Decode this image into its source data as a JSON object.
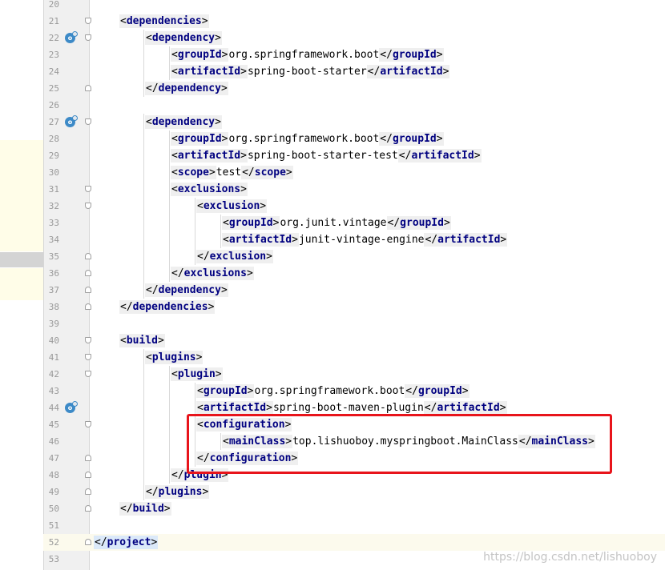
{
  "editor": {
    "lines": [
      {
        "n": "20",
        "indent": 0,
        "parts": [],
        "fold": null,
        "icon": false
      },
      {
        "n": "21",
        "indent": 1,
        "parts": [
          [
            "open",
            "dependencies"
          ]
        ],
        "fold": "open",
        "icon": false
      },
      {
        "n": "22",
        "indent": 2,
        "parts": [
          [
            "open",
            "dependency"
          ]
        ],
        "fold": "open",
        "icon": true
      },
      {
        "n": "23",
        "indent": 3,
        "parts": [
          [
            "open",
            "groupId"
          ],
          [
            "text",
            "org.springframework.boot"
          ],
          [
            "close",
            "groupId"
          ]
        ],
        "fold": null,
        "icon": false
      },
      {
        "n": "24",
        "indent": 3,
        "parts": [
          [
            "open",
            "artifactId"
          ],
          [
            "text",
            "spring-boot-starter"
          ],
          [
            "close",
            "artifactId"
          ]
        ],
        "fold": null,
        "icon": false
      },
      {
        "n": "25",
        "indent": 2,
        "parts": [
          [
            "close",
            "dependency"
          ]
        ],
        "fold": "close",
        "icon": false
      },
      {
        "n": "26",
        "indent": 0,
        "parts": [],
        "fold": null,
        "icon": false
      },
      {
        "n": "27",
        "indent": 2,
        "parts": [
          [
            "open",
            "dependency"
          ]
        ],
        "fold": "open",
        "icon": true
      },
      {
        "n": "28",
        "indent": 3,
        "parts": [
          [
            "open",
            "groupId"
          ],
          [
            "text",
            "org.springframework.boot"
          ],
          [
            "close",
            "groupId"
          ]
        ],
        "fold": null,
        "icon": false
      },
      {
        "n": "29",
        "indent": 3,
        "parts": [
          [
            "open",
            "artifactId"
          ],
          [
            "text",
            "spring-boot-starter-test"
          ],
          [
            "close",
            "artifactId"
          ]
        ],
        "fold": null,
        "icon": false
      },
      {
        "n": "30",
        "indent": 3,
        "parts": [
          [
            "open",
            "scope"
          ],
          [
            "text",
            "test"
          ],
          [
            "close",
            "scope"
          ]
        ],
        "fold": null,
        "icon": false
      },
      {
        "n": "31",
        "indent": 3,
        "parts": [
          [
            "open",
            "exclusions"
          ]
        ],
        "fold": "open",
        "icon": false
      },
      {
        "n": "32",
        "indent": 4,
        "parts": [
          [
            "open",
            "exclusion"
          ]
        ],
        "fold": "open",
        "icon": false
      },
      {
        "n": "33",
        "indent": 5,
        "parts": [
          [
            "open",
            "groupId"
          ],
          [
            "text",
            "org.junit.vintage"
          ],
          [
            "close",
            "groupId"
          ]
        ],
        "fold": null,
        "icon": false
      },
      {
        "n": "34",
        "indent": 5,
        "parts": [
          [
            "open",
            "artifactId"
          ],
          [
            "text",
            "junit-vintage-engine"
          ],
          [
            "close",
            "artifactId"
          ]
        ],
        "fold": null,
        "icon": false
      },
      {
        "n": "35",
        "indent": 4,
        "parts": [
          [
            "close",
            "exclusion"
          ]
        ],
        "fold": "close",
        "icon": false
      },
      {
        "n": "36",
        "indent": 3,
        "parts": [
          [
            "close",
            "exclusions"
          ]
        ],
        "fold": "close",
        "icon": false
      },
      {
        "n": "37",
        "indent": 2,
        "parts": [
          [
            "close",
            "dependency"
          ]
        ],
        "fold": "close",
        "icon": false
      },
      {
        "n": "38",
        "indent": 1,
        "parts": [
          [
            "close",
            "dependencies"
          ]
        ],
        "fold": "close",
        "icon": false
      },
      {
        "n": "39",
        "indent": 0,
        "parts": [],
        "fold": null,
        "icon": false
      },
      {
        "n": "40",
        "indent": 1,
        "parts": [
          [
            "open",
            "build"
          ]
        ],
        "fold": "open",
        "icon": false
      },
      {
        "n": "41",
        "indent": 2,
        "parts": [
          [
            "open",
            "plugins"
          ]
        ],
        "fold": "open",
        "icon": false
      },
      {
        "n": "42",
        "indent": 3,
        "parts": [
          [
            "open",
            "plugin"
          ]
        ],
        "fold": "open",
        "icon": false
      },
      {
        "n": "43",
        "indent": 4,
        "parts": [
          [
            "open",
            "groupId"
          ],
          [
            "text",
            "org.springframework.boot"
          ],
          [
            "close",
            "groupId"
          ]
        ],
        "fold": null,
        "icon": false
      },
      {
        "n": "44",
        "indent": 4,
        "parts": [
          [
            "open",
            "artifactId"
          ],
          [
            "text",
            "spring-boot-maven-plugin"
          ],
          [
            "close",
            "artifactId"
          ]
        ],
        "fold": null,
        "icon": true
      },
      {
        "n": "45",
        "indent": 4,
        "parts": [
          [
            "open",
            "configuration"
          ]
        ],
        "fold": "open",
        "icon": false
      },
      {
        "n": "46",
        "indent": 5,
        "parts": [
          [
            "open",
            "mainClass"
          ],
          [
            "text",
            "top.lishuoboy.myspringboot.MainClass"
          ],
          [
            "close",
            "mainClass"
          ]
        ],
        "fold": null,
        "icon": false
      },
      {
        "n": "47",
        "indent": 4,
        "parts": [
          [
            "close",
            "configuration"
          ]
        ],
        "fold": "close",
        "icon": false
      },
      {
        "n": "48",
        "indent": 3,
        "parts": [
          [
            "close",
            "plugin"
          ]
        ],
        "fold": "close",
        "icon": false
      },
      {
        "n": "49",
        "indent": 2,
        "parts": [
          [
            "close",
            "plugins"
          ]
        ],
        "fold": "close",
        "icon": false
      },
      {
        "n": "50",
        "indent": 1,
        "parts": [
          [
            "close",
            "build"
          ]
        ],
        "fold": "close",
        "icon": false
      },
      {
        "n": "51",
        "indent": 0,
        "parts": [],
        "fold": null,
        "icon": false
      },
      {
        "n": "52",
        "indent": 0,
        "parts": [
          [
            "close",
            "project"
          ]
        ],
        "fold": "close",
        "icon": false,
        "current": true
      },
      {
        "n": "53",
        "indent": 0,
        "parts": [],
        "fold": null,
        "icon": false
      }
    ],
    "watermark": "https://blog.csdn.net/lishuoboy"
  },
  "colors": {
    "tag_name": "#000080",
    "text": "#000000",
    "annotation": "#e8141b"
  }
}
